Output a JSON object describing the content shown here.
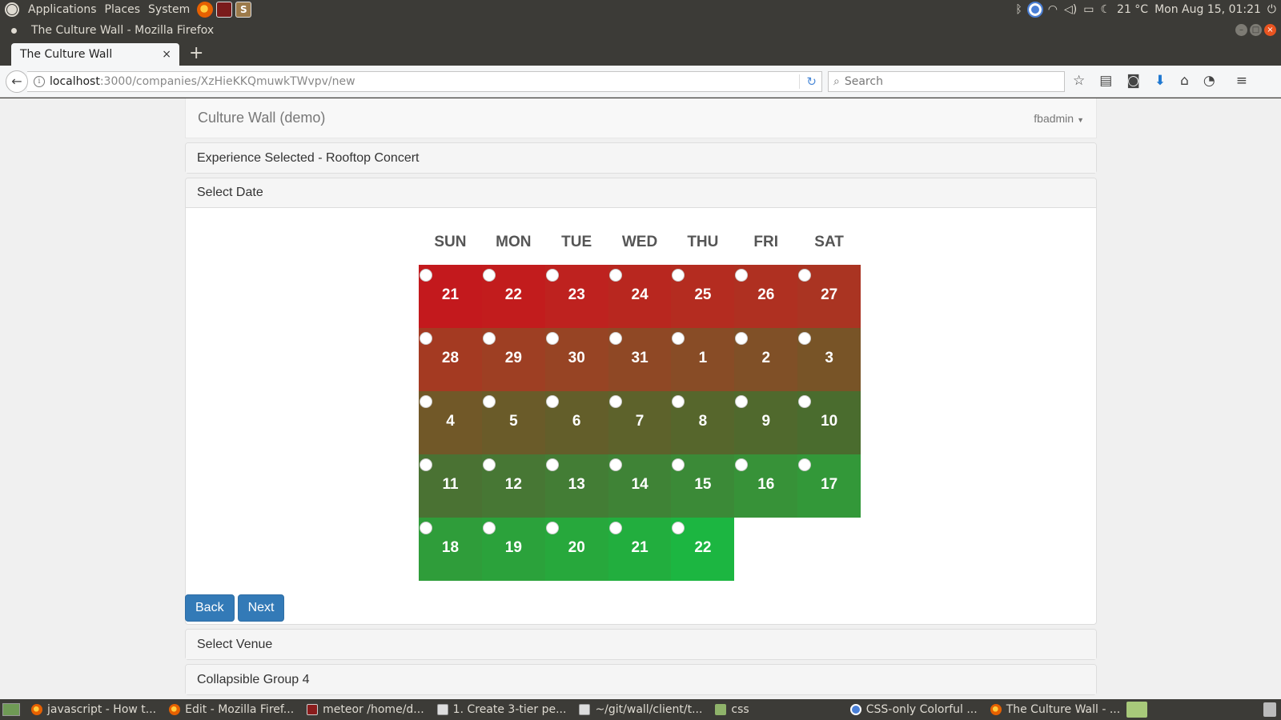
{
  "os_panel": {
    "menus": [
      "Applications",
      "Places",
      "System"
    ],
    "temperature": "21 °C",
    "datetime": "Mon Aug 15, 01:21"
  },
  "window": {
    "title": "The Culture Wall - Mozilla Firefox"
  },
  "browser": {
    "tab_title": "The Culture Wall",
    "tab_close": "×",
    "new_tab": "+",
    "url_host": "localhost",
    "url_path": ":3000/companies/XzHieKKQmuwkTWvpv/new",
    "search_placeholder": "Search"
  },
  "app": {
    "brand": "Culture Wall (demo)",
    "user": "fbadmin",
    "panels": {
      "experience": "Experience Selected - Rooftop Concert",
      "date": "Select Date",
      "venue": "Select Venue",
      "group4": "Collapsible Group 4"
    },
    "buttons": {
      "back": "Back",
      "next": "Next"
    }
  },
  "calendar": {
    "weekdays": [
      "SUN",
      "MON",
      "TUE",
      "WED",
      "THU",
      "FRI",
      "SAT"
    ],
    "weeks": [
      [
        {
          "d": "21",
          "c": "#c3191d"
        },
        {
          "d": "22",
          "c": "#c21c1d"
        },
        {
          "d": "23",
          "c": "#be221f"
        },
        {
          "d": "24",
          "c": "#b8271f"
        },
        {
          "d": "25",
          "c": "#b42c20"
        },
        {
          "d": "26",
          "c": "#af3021"
        },
        {
          "d": "27",
          "c": "#aa3422"
        }
      ],
      [
        {
          "d": "28",
          "c": "#a43a22"
        },
        {
          "d": "29",
          "c": "#9e3f23"
        },
        {
          "d": "30",
          "c": "#974424"
        },
        {
          "d": "31",
          "c": "#8f4825"
        },
        {
          "d": "1",
          "c": "#884c26"
        },
        {
          "d": "2",
          "c": "#805027"
        },
        {
          "d": "3",
          "c": "#785427"
        }
      ],
      [
        {
          "d": "4",
          "c": "#715828"
        },
        {
          "d": "5",
          "c": "#6a5b29"
        },
        {
          "d": "6",
          "c": "#635e2a"
        },
        {
          "d": "7",
          "c": "#5d622b"
        },
        {
          "d": "8",
          "c": "#56662c"
        },
        {
          "d": "9",
          "c": "#50692d"
        },
        {
          "d": "10",
          "c": "#4a6c2e"
        }
      ],
      [
        {
          "d": "11",
          "c": "#4a7233"
        },
        {
          "d": "12",
          "c": "#477734"
        },
        {
          "d": "13",
          "c": "#437d35"
        },
        {
          "d": "14",
          "c": "#3f8336"
        },
        {
          "d": "15",
          "c": "#3b8a37"
        },
        {
          "d": "16",
          "c": "#379238"
        },
        {
          "d": "17",
          "c": "#339839"
        }
      ],
      [
        {
          "d": "18",
          "c": "#2f9d3a"
        },
        {
          "d": "19",
          "c": "#2ba23b"
        },
        {
          "d": "20",
          "c": "#27a83c"
        },
        {
          "d": "21",
          "c": "#22ae3e"
        },
        {
          "d": "22",
          "c": "#1cb641"
        },
        {
          "d": "",
          "c": ""
        },
        {
          "d": "",
          "c": ""
        }
      ]
    ]
  },
  "taskbar": {
    "tasks": [
      {
        "label": "javascript - How t...",
        "icon": "firefox-icon"
      },
      {
        "label": "Edit - Mozilla Firef...",
        "icon": "firefox-icon"
      },
      {
        "label": "meteor /home/d...",
        "icon": "terminal-icon"
      },
      {
        "label": "1. Create 3-tier pe...",
        "icon": "document-icon"
      },
      {
        "label": "~/git/wall/client/t...",
        "icon": "document-icon"
      },
      {
        "label": "css",
        "icon": "folder-icon"
      },
      {
        "label": "CSS-only Colorful ...",
        "icon": "chrome-icon"
      },
      {
        "label": "The Culture Wall - ...",
        "icon": "firefox-icon"
      }
    ]
  }
}
